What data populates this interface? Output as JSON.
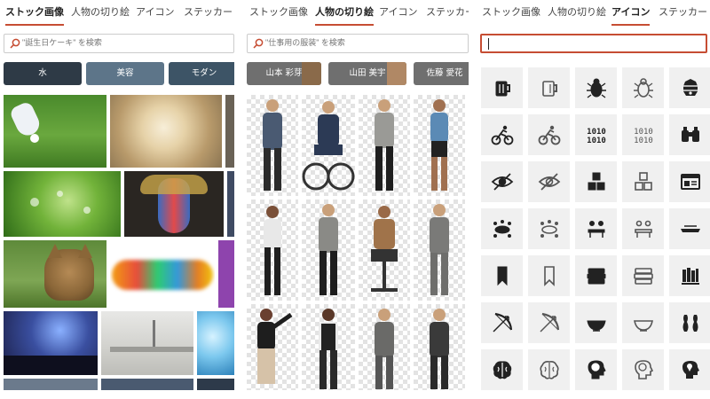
{
  "panels": [
    {
      "tabs": [
        {
          "label": "ストック画像",
          "active": true
        },
        {
          "label": "人物の切り絵",
          "active": false
        },
        {
          "label": "アイコン",
          "active": false
        },
        {
          "label": "ステッカー",
          "active": false
        }
      ],
      "search_placeholder": "\"誕生日ケーキ\" を検索",
      "chips": [
        "水",
        "美容",
        "モダン"
      ]
    },
    {
      "tabs": [
        {
          "label": "ストック画像",
          "active": false
        },
        {
          "label": "人物の切り絵",
          "active": true
        },
        {
          "label": "アイコン",
          "active": false
        },
        {
          "label": "ステッカー",
          "active": false
        }
      ],
      "search_placeholder": "\"仕事用の服装\" を検索",
      "chips": [
        "山本 彩芽",
        "山田 美宇",
        "佐藤 愛花"
      ]
    },
    {
      "tabs": [
        {
          "label": "ストック画像",
          "active": false
        },
        {
          "label": "人物の切り絵",
          "active": false
        },
        {
          "label": "アイコン",
          "active": true
        },
        {
          "label": "ステッカー",
          "active": false
        }
      ],
      "search_value": ""
    }
  ],
  "icon_grid": [
    [
      "beer-mug-filled-icon",
      "beer-mug-outline-icon",
      "bug-filled-icon",
      "bug-outline-icon",
      "beehive-icon"
    ],
    [
      "cyclist-filled-icon",
      "cyclist-outline-icon",
      "binary-filled-icon",
      "binary-outline-icon",
      "binoculars-icon"
    ],
    [
      "eye-hidden-filled-icon",
      "eye-hidden-outline-icon",
      "cubes-filled-icon",
      "cubes-outline-icon",
      "browser-window-icon"
    ],
    [
      "meeting-table-filled-icon",
      "meeting-table-outline-icon",
      "desk-meeting-filled-icon",
      "desk-meeting-outline-icon",
      "tray-icon"
    ],
    [
      "bookmark-filled-icon",
      "bookmark-outline-icon",
      "book-stack-filled-icon",
      "book-stack-outline-icon",
      "bookshelf-icon"
    ],
    [
      "bow-arrow-filled-icon",
      "bow-arrow-outline-icon",
      "bowl-filled-icon",
      "bowl-outline-icon",
      "bowling-icon"
    ],
    [
      "brain-filled-icon",
      "brain-outline-icon",
      "head-brain-filled-icon",
      "head-brain-outline-icon",
      "head-pin-icon"
    ]
  ],
  "colors": {
    "accent": "#c64d33",
    "cell_bg": "#f0f0f0",
    "icon_dark": "#222222",
    "icon_outline": "#555555"
  }
}
